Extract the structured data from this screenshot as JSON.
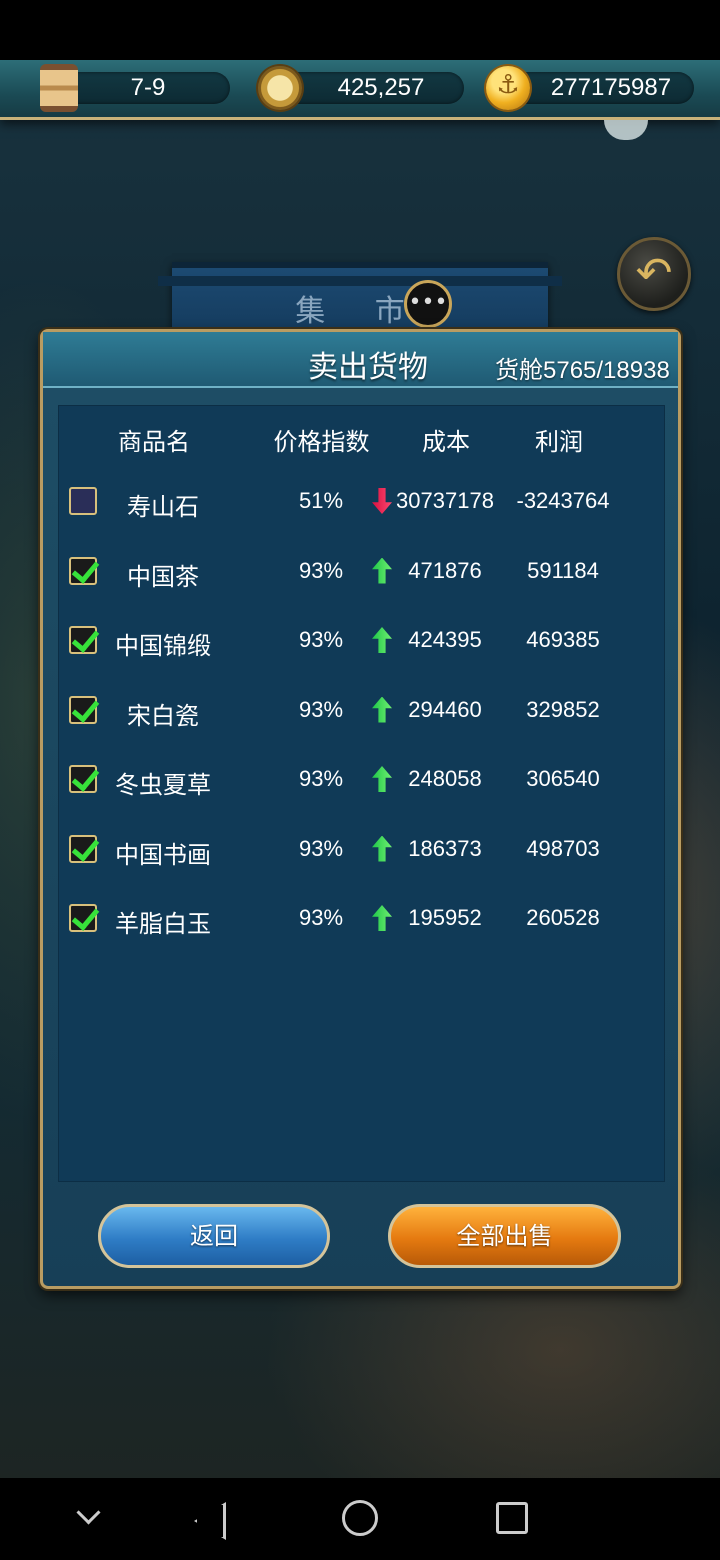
{
  "topbar": {
    "time_value": "7-9",
    "compass_value": "425,257",
    "gold_value": "277175987",
    "icons": [
      "hourglass-icon",
      "compass-icon",
      "anchor-coin-icon"
    ]
  },
  "market": {
    "title": "集 市"
  },
  "panel": {
    "title": "卖出货物",
    "cargo_label": "货舱",
    "cargo_value": "5765/18938",
    "headers": {
      "name": "商品名",
      "price_index": "价格指数",
      "cost": "成本",
      "profit": "利润"
    },
    "rows": [
      {
        "name": "寿山石",
        "price_index": "51%",
        "trend": "down",
        "cost": "30737178",
        "profit": "-3243764",
        "checked": false
      },
      {
        "name": "中国茶",
        "price_index": "93%",
        "trend": "up",
        "cost": "471876",
        "profit": "591184",
        "checked": true
      },
      {
        "name": "中国锦缎",
        "price_index": "93%",
        "trend": "up",
        "cost": "424395",
        "profit": "469385",
        "checked": true
      },
      {
        "name": "宋白瓷",
        "price_index": "93%",
        "trend": "up",
        "cost": "294460",
        "profit": "329852",
        "checked": true
      },
      {
        "name": "冬虫夏草",
        "price_index": "93%",
        "trend": "up",
        "cost": "248058",
        "profit": "306540",
        "checked": true
      },
      {
        "name": "中国书画",
        "price_index": "93%",
        "trend": "up",
        "cost": "186373",
        "profit": "498703",
        "checked": true
      },
      {
        "name": "羊脂白玉",
        "price_index": "93%",
        "trend": "up",
        "cost": "195952",
        "profit": "260528",
        "checked": true
      }
    ],
    "return_label": "返回",
    "sell_all_label": "全部出售"
  },
  "colors": {
    "up_arrow": "#37e23a",
    "down_arrow": "#e0144a",
    "panel_bg": "#173f57",
    "return_button": "#2f7dc6",
    "sell_button": "#e57a10"
  }
}
